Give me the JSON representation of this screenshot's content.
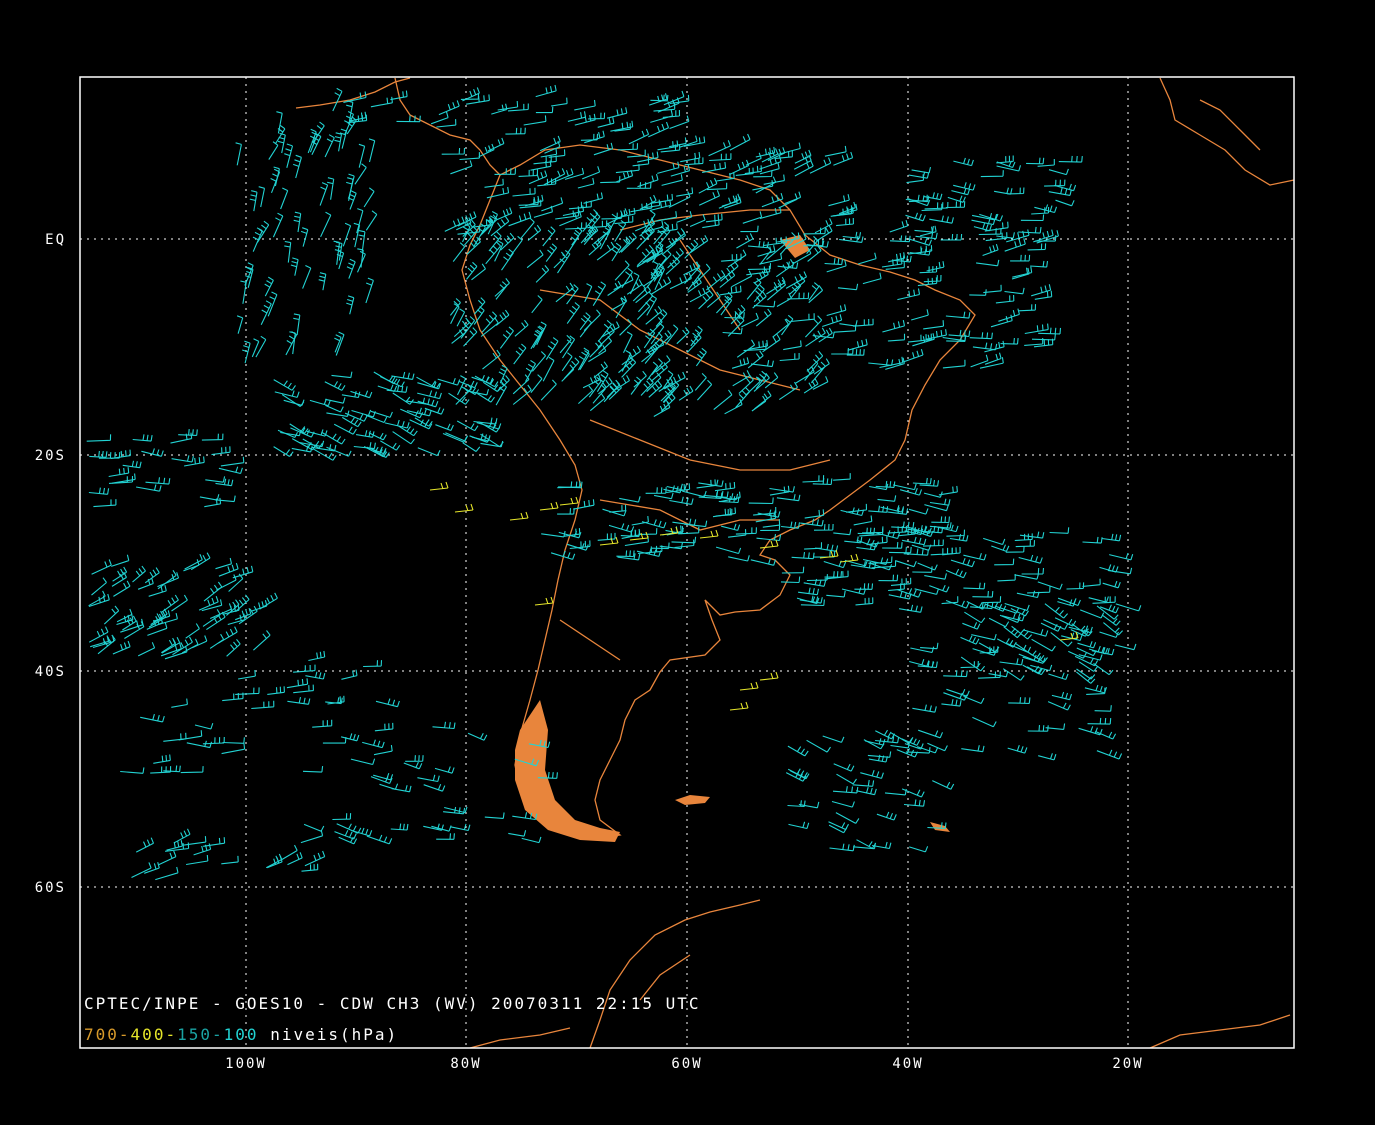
{
  "title_line": "CPTEC/INPE - GOES10 - CDW CH3 (WV) 20070311 22:15 UTC",
  "levels": [
    {
      "text": "700",
      "color": "#d89a2a"
    },
    {
      "text": "400",
      "color": "#e6e62a"
    },
    {
      "text": "150",
      "color": "#1aa3a3"
    },
    {
      "text": "100",
      "color": "#22d3d3"
    }
  ],
  "levels_suffix": "niveis(hPa)",
  "lat_labels": [
    "EQ",
    "20S",
    "40S",
    "60S"
  ],
  "lon_labels": [
    "100W",
    "80W",
    "60W",
    "40W",
    "20W"
  ],
  "colors": {
    "background": "#000000",
    "frame": "#ffffff",
    "coastline": "#e8853c",
    "barbs_upper": "#22d3d3",
    "barbs_mid": "#e6e62a"
  },
  "icons": {
    "wind_barb": "wind-barb-icon"
  }
}
